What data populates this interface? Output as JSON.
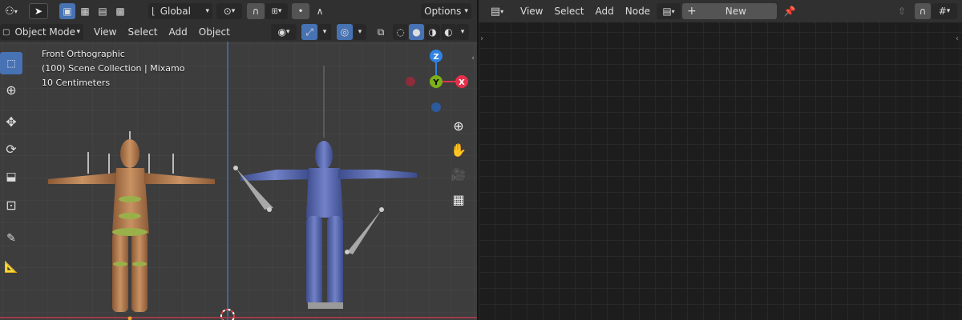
{
  "viewport": {
    "header": {
      "orientation_label": "Global",
      "options_label": "Options"
    },
    "subheader": {
      "mode_label": "Object Mode",
      "menus": [
        "View",
        "Select",
        "Add",
        "Object"
      ]
    },
    "overlay_info": {
      "view_name": "Front Orthographic",
      "collection": "(100) Scene Collection | Mixamo",
      "scale": "10 Centimeters"
    },
    "gizmo": {
      "z_label": "Z",
      "y_label": "Y",
      "x_label": "X"
    },
    "colors": {
      "background": "#3d3d3d",
      "header": "#303030",
      "accent": "#4772b3",
      "axis_z": "#2f83e4",
      "axis_y": "#7cb01a",
      "axis_x": "#e6304b",
      "mannequin_left": "#b07a4d",
      "mannequin_right": "#5b6fb3"
    }
  },
  "node_editor": {
    "menus": [
      "View",
      "Select",
      "Add",
      "Node"
    ],
    "new_button_label": "New",
    "colors": {
      "background": "#1d1d1d",
      "grid": "#282828"
    }
  }
}
